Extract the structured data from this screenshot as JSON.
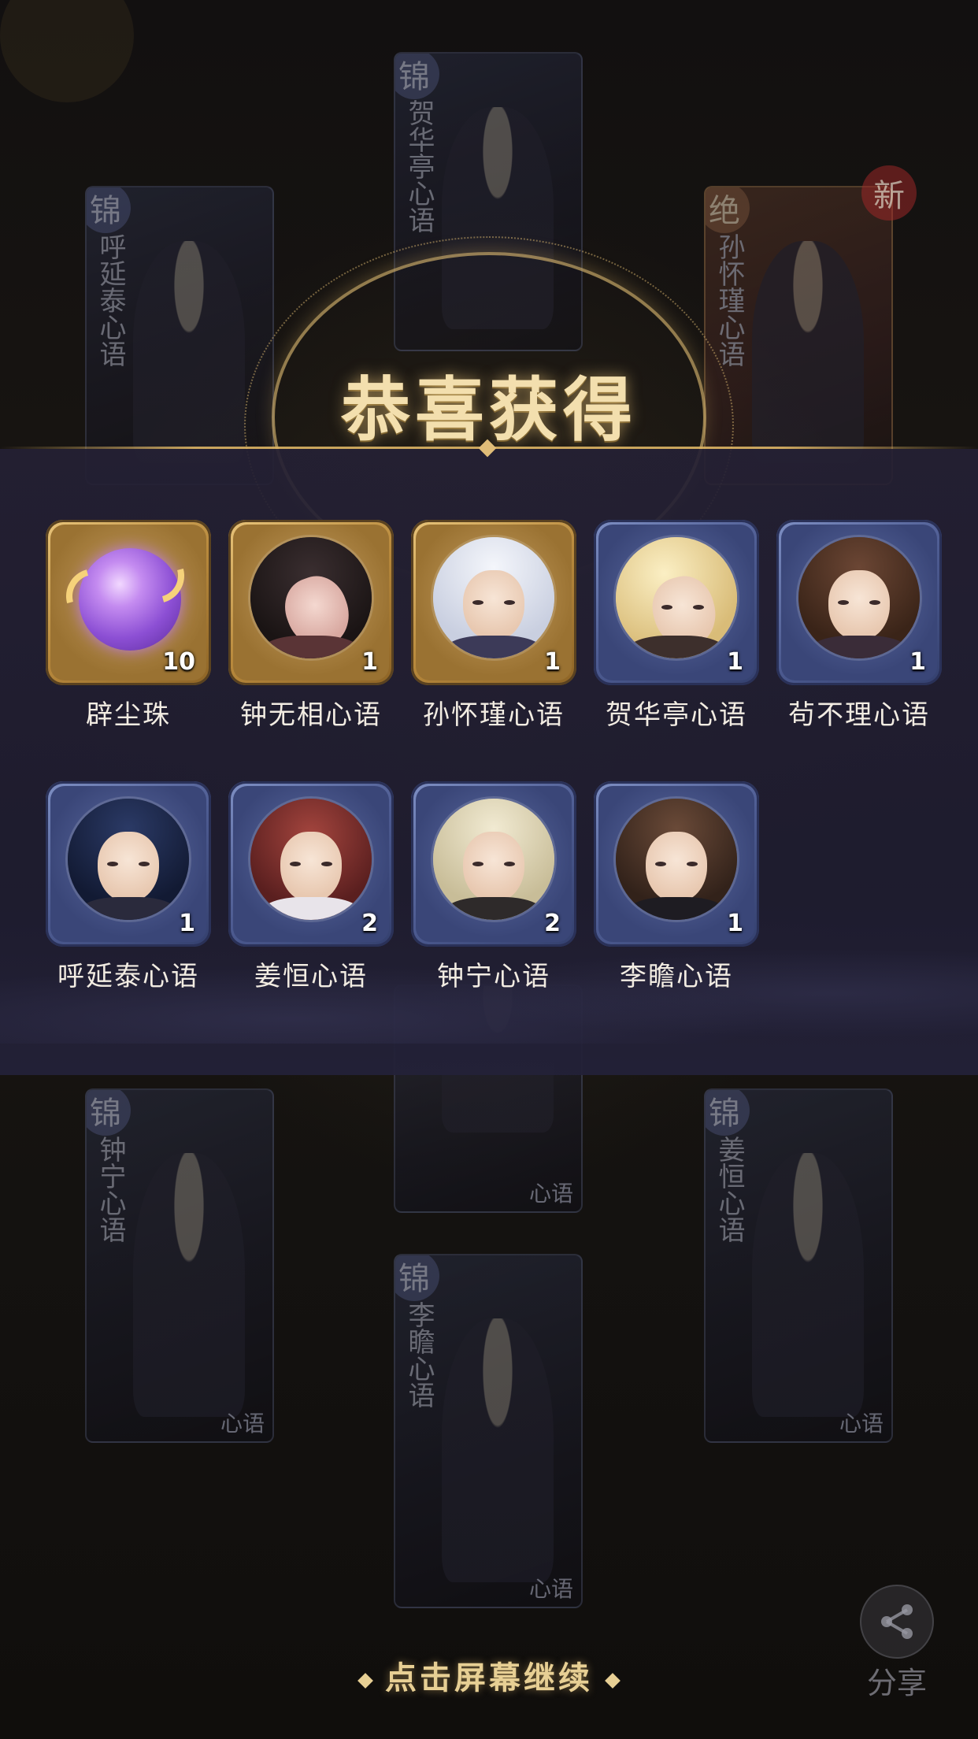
{
  "title": "恭喜获得",
  "background_cards": [
    {
      "rank": "锦",
      "name": "呼延泰心语"
    },
    {
      "rank": "锦",
      "name": "贺华亭心语"
    },
    {
      "rank": "绝",
      "name": "孙怀瑾心语",
      "tag": "新"
    },
    {
      "rank": "锦",
      "name": "钟宁心语",
      "footer": "心语"
    },
    {
      "rank": "锦",
      "name": "姜恒心语",
      "footer": "心语"
    },
    {
      "rank": "锦",
      "name": "李瞻心语",
      "footer": "心语"
    },
    {
      "footer": "心语"
    }
  ],
  "rewards": [
    {
      "name": "辟尘珠",
      "count": "10",
      "frame": "gold",
      "icon": "purple-orb-icon"
    },
    {
      "name": "钟无相心语",
      "count": "1",
      "frame": "gold"
    },
    {
      "name": "孙怀瑾心语",
      "count": "1",
      "frame": "gold"
    },
    {
      "name": "贺华亭心语",
      "count": "1",
      "frame": "blue"
    },
    {
      "name": "茍不理心语",
      "count": "1",
      "frame": "blue"
    },
    {
      "name": "呼延泰心语",
      "count": "1",
      "frame": "blue"
    },
    {
      "name": "姜恒心语",
      "count": "2",
      "frame": "blue"
    },
    {
      "name": "钟宁心语",
      "count": "2",
      "frame": "blue"
    },
    {
      "name": "李瞻心语",
      "count": "1",
      "frame": "blue"
    }
  ],
  "continue_text": "点击屏幕继续",
  "share": {
    "label": "分享",
    "icon": "share-icon"
  },
  "colors": {
    "gold_frame": "#c9a05a",
    "blue_frame": "#5b6aa0",
    "title": "#f3dfae"
  }
}
